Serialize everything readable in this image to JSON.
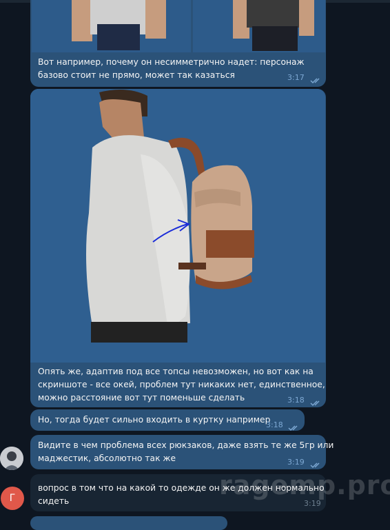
{
  "messages": [
    {
      "text": "Вот например, почему он несимметрично надет: персонаж\nбазово стоит не прямо, может так казаться",
      "time": "3:17"
    },
    {
      "text": "Опять же, адаптив под все топсы невозможен, но вот как на\nскриншоте - все окей, проблем тут никаких нет, единственное,\nможно расстояние вот тут поменьше сделать",
      "time": "3:18"
    },
    {
      "text": "Но, тогда будет сильно входить в куртку например",
      "time": "3:18"
    },
    {
      "text": "Видите в чем проблема всех рюкзаков, даже взять те же 5гр или\nмаджестик, абсолютно так же",
      "time": "3:19"
    },
    {
      "text": "вопрос в том что на какой то одежде он же должен нормально\nсидеть",
      "time": "3:19"
    }
  ],
  "avatar_letter": "Г",
  "watermark": "ragemp.pro",
  "colors": {
    "background": "#0e1621",
    "outgoing_bubble": "#2b5278",
    "incoming_bubble": "#182533",
    "time_outgoing": "#7da8d3",
    "avatar_letter_bg": "#e0584a"
  }
}
